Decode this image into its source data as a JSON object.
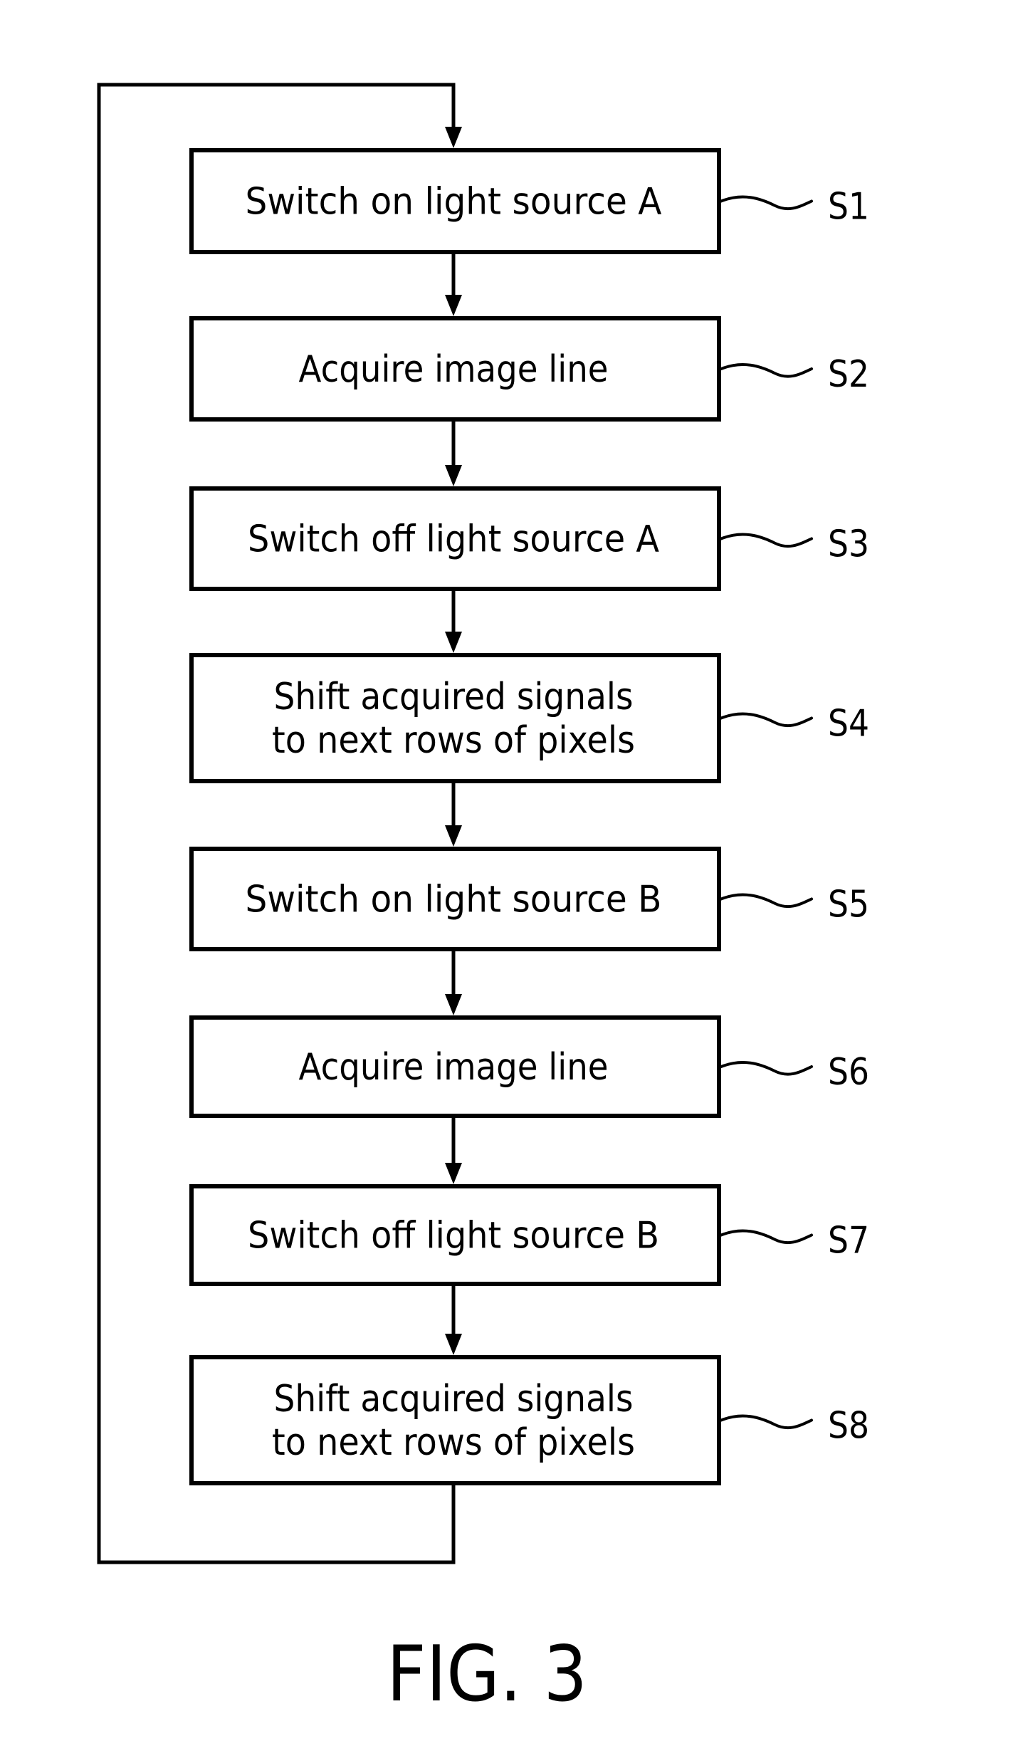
{
  "figure": {
    "caption": "FIG. 3",
    "type": "flowchart",
    "loops_back": true
  },
  "steps": [
    {
      "ref": "S1",
      "lines": [
        "Switch on light source A"
      ]
    },
    {
      "ref": "S2",
      "lines": [
        "Acquire image line"
      ]
    },
    {
      "ref": "S3",
      "lines": [
        "Switch off light source A"
      ]
    },
    {
      "ref": "S4",
      "lines": [
        "Shift acquired signals",
        "to next rows of pixels"
      ]
    },
    {
      "ref": "S5",
      "lines": [
        "Switch on light source B"
      ]
    },
    {
      "ref": "S6",
      "lines": [
        "Acquire image line"
      ]
    },
    {
      "ref": "S7",
      "lines": [
        "Switch off light source B"
      ]
    },
    {
      "ref": "S8",
      "lines": [
        "Shift acquired signals",
        "to next rows of pixels"
      ]
    }
  ],
  "colors": {
    "ink": "#000000",
    "background": "#ffffff"
  }
}
